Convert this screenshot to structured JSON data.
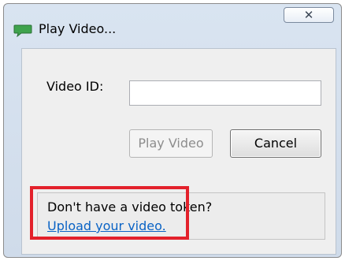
{
  "window": {
    "title": "Play Video...",
    "close_glyph": "✕"
  },
  "form": {
    "video_id_label": "Video ID:",
    "video_id_value": ""
  },
  "buttons": {
    "play_label": "Play Video",
    "cancel_label": "Cancel"
  },
  "token_panel": {
    "question": "Don't have a video token?",
    "link_text": "Upload your video."
  },
  "colors": {
    "highlight": "#e3212b",
    "link": "#0a63c5",
    "app_icon": "#3fa34d"
  },
  "icons": {
    "app": "speech-bubble-icon",
    "close": "close-icon"
  }
}
